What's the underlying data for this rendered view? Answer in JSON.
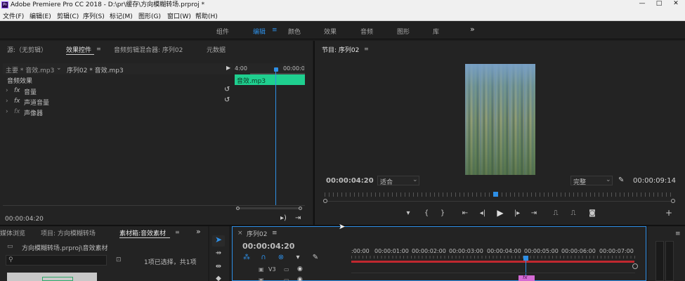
{
  "titlebar": {
    "logo_text": "Pr",
    "title": "Adobe Premiere Pro CC 2018 - D:\\pr\\缓存\\方向模糊转场.prproj *",
    "minimize": "—",
    "restore": "□",
    "close": "✕"
  },
  "menu": [
    "文件(F)",
    "编辑(E)",
    "剪辑(C)",
    "序列(S)",
    "标记(M)",
    "图形(G)",
    "窗口(W)",
    "帮助(H)"
  ],
  "workspaces": {
    "items": [
      "组件",
      "编辑",
      "颜色",
      "效果",
      "音频",
      "图形",
      "库"
    ],
    "active": "编辑",
    "overflow": "»"
  },
  "effect_controls": {
    "tabs": [
      "源:（无剪辑）",
      "效果控件",
      "音频剪辑混合器: 序列02",
      "元数据"
    ],
    "master_label": "主要 * 音效.mp3",
    "sequence_label": "序列02 * 音效.mp3",
    "section": "音频效果",
    "effects": [
      {
        "fx": "fx",
        "name": "音量"
      },
      {
        "fx": "fx",
        "name": "声道音量"
      },
      {
        "fx": "fx",
        "name": "声像器"
      }
    ],
    "mini_time_start": "4:00",
    "mini_time_end": "00:00:0",
    "clip_name": "音效.mp3",
    "timecode": "00:00:04:20"
  },
  "program_monitor": {
    "title": "节目: 序列02",
    "timecode": "00:00:04:20",
    "fit": "适合",
    "quality": "完整",
    "duration": "00:00:09:14"
  },
  "project": {
    "tabs": [
      "媒体浏览",
      "项目: 方向模糊转场",
      "素材箱:音效素材"
    ],
    "path": "方向模糊转场.prproj\\音效素材",
    "selection": "1项已选择，共1项"
  },
  "timeline": {
    "tab": "序列02",
    "timecode": "00:00:04:20",
    "ruler": [
      ":00:00",
      "00:00:01:00",
      "00:00:02:00",
      "00:00:03:00",
      "00:00:04:00",
      "00:00:05:00",
      "00:00:06:00",
      "00:00:07:00"
    ],
    "track_v3": "V3",
    "track_next": "V2",
    "clip_label": "fx"
  },
  "colors": {
    "accent": "#2e8fe6",
    "clip_audio": "#1fcf8f",
    "work_area": "#c0282f",
    "clip_pink": "#d46ad4"
  }
}
